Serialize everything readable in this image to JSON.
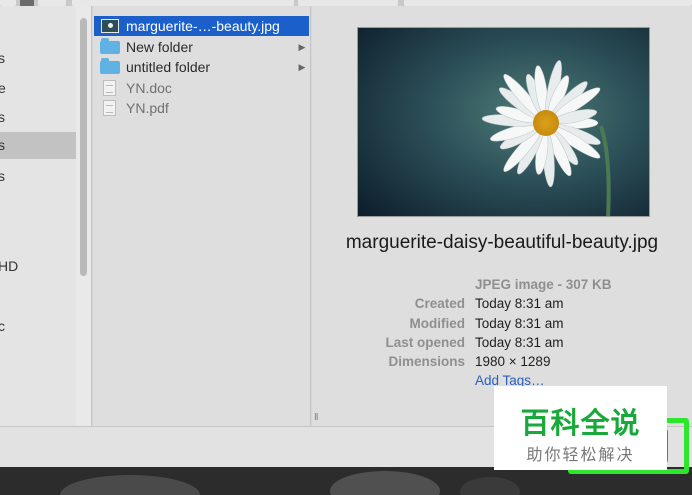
{
  "sidebar": {
    "items": [
      {
        "label": "s"
      },
      {
        "label": "e"
      },
      {
        "label": "s"
      },
      {
        "label": "s"
      },
      {
        "label": "s"
      },
      {
        "label": "HD"
      },
      {
        "label": "c"
      }
    ]
  },
  "file_list": {
    "rows": [
      {
        "label": "marguerite-…-beauty.jpg",
        "icon": "image-file-icon",
        "selected": true
      },
      {
        "label": "New folder",
        "icon": "folder-icon",
        "has_children": true
      },
      {
        "label": "untitled folder",
        "icon": "folder-icon",
        "has_children": true
      },
      {
        "label": "YN.doc",
        "icon": "document-icon"
      },
      {
        "label": "YN.pdf",
        "icon": "pdf-file-icon"
      }
    ]
  },
  "preview": {
    "title": "marguerite-daisy-beautiful-beauty.jpg",
    "kind_size": "JPEG image - 307 KB",
    "meta": [
      {
        "key": "Created",
        "value": "Today 8:31 am"
      },
      {
        "key": "Modified",
        "value": "Today 8:31 am"
      },
      {
        "key": "Last opened",
        "value": "Today 8:31 am"
      },
      {
        "key": "Dimensions",
        "value": "1980 × 1289"
      }
    ],
    "add_tags": "Add Tags…"
  },
  "resize_handle": "II",
  "colors": {
    "selection": "#1b5fcb",
    "highlight_outline": "#2ee62e",
    "button_blue": "#2d7ff0",
    "watermark_green": "#18a93a"
  },
  "watermark": {
    "title": "百科全说",
    "subtitle": "助你轻松解决"
  }
}
